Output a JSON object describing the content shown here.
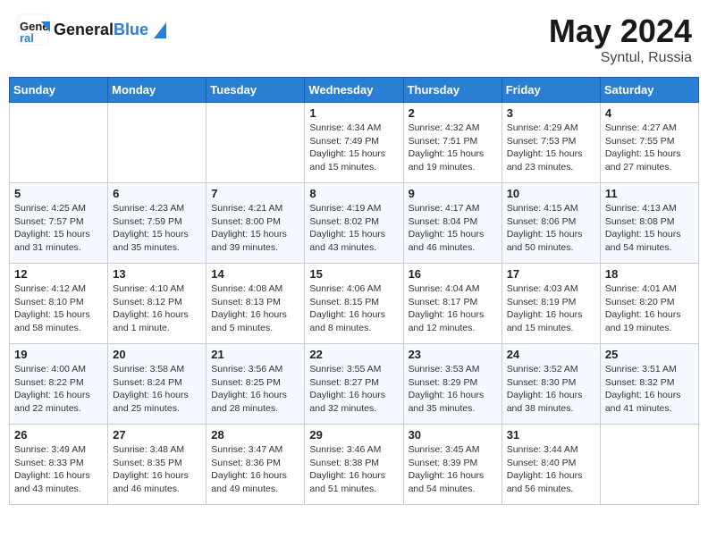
{
  "header": {
    "logo_line1": "General",
    "logo_line2": "Blue",
    "title": "May 2024",
    "location": "Syntul, Russia"
  },
  "weekdays": [
    "Sunday",
    "Monday",
    "Tuesday",
    "Wednesday",
    "Thursday",
    "Friday",
    "Saturday"
  ],
  "weeks": [
    [
      {
        "day": "",
        "info": ""
      },
      {
        "day": "",
        "info": ""
      },
      {
        "day": "",
        "info": ""
      },
      {
        "day": "1",
        "info": "Sunrise: 4:34 AM\nSunset: 7:49 PM\nDaylight: 15 hours\nand 15 minutes."
      },
      {
        "day": "2",
        "info": "Sunrise: 4:32 AM\nSunset: 7:51 PM\nDaylight: 15 hours\nand 19 minutes."
      },
      {
        "day": "3",
        "info": "Sunrise: 4:29 AM\nSunset: 7:53 PM\nDaylight: 15 hours\nand 23 minutes."
      },
      {
        "day": "4",
        "info": "Sunrise: 4:27 AM\nSunset: 7:55 PM\nDaylight: 15 hours\nand 27 minutes."
      }
    ],
    [
      {
        "day": "5",
        "info": "Sunrise: 4:25 AM\nSunset: 7:57 PM\nDaylight: 15 hours\nand 31 minutes."
      },
      {
        "day": "6",
        "info": "Sunrise: 4:23 AM\nSunset: 7:59 PM\nDaylight: 15 hours\nand 35 minutes."
      },
      {
        "day": "7",
        "info": "Sunrise: 4:21 AM\nSunset: 8:00 PM\nDaylight: 15 hours\nand 39 minutes."
      },
      {
        "day": "8",
        "info": "Sunrise: 4:19 AM\nSunset: 8:02 PM\nDaylight: 15 hours\nand 43 minutes."
      },
      {
        "day": "9",
        "info": "Sunrise: 4:17 AM\nSunset: 8:04 PM\nDaylight: 15 hours\nand 46 minutes."
      },
      {
        "day": "10",
        "info": "Sunrise: 4:15 AM\nSunset: 8:06 PM\nDaylight: 15 hours\nand 50 minutes."
      },
      {
        "day": "11",
        "info": "Sunrise: 4:13 AM\nSunset: 8:08 PM\nDaylight: 15 hours\nand 54 minutes."
      }
    ],
    [
      {
        "day": "12",
        "info": "Sunrise: 4:12 AM\nSunset: 8:10 PM\nDaylight: 15 hours\nand 58 minutes."
      },
      {
        "day": "13",
        "info": "Sunrise: 4:10 AM\nSunset: 8:12 PM\nDaylight: 16 hours\nand 1 minute."
      },
      {
        "day": "14",
        "info": "Sunrise: 4:08 AM\nSunset: 8:13 PM\nDaylight: 16 hours\nand 5 minutes."
      },
      {
        "day": "15",
        "info": "Sunrise: 4:06 AM\nSunset: 8:15 PM\nDaylight: 16 hours\nand 8 minutes."
      },
      {
        "day": "16",
        "info": "Sunrise: 4:04 AM\nSunset: 8:17 PM\nDaylight: 16 hours\nand 12 minutes."
      },
      {
        "day": "17",
        "info": "Sunrise: 4:03 AM\nSunset: 8:19 PM\nDaylight: 16 hours\nand 15 minutes."
      },
      {
        "day": "18",
        "info": "Sunrise: 4:01 AM\nSunset: 8:20 PM\nDaylight: 16 hours\nand 19 minutes."
      }
    ],
    [
      {
        "day": "19",
        "info": "Sunrise: 4:00 AM\nSunset: 8:22 PM\nDaylight: 16 hours\nand 22 minutes."
      },
      {
        "day": "20",
        "info": "Sunrise: 3:58 AM\nSunset: 8:24 PM\nDaylight: 16 hours\nand 25 minutes."
      },
      {
        "day": "21",
        "info": "Sunrise: 3:56 AM\nSunset: 8:25 PM\nDaylight: 16 hours\nand 28 minutes."
      },
      {
        "day": "22",
        "info": "Sunrise: 3:55 AM\nSunset: 8:27 PM\nDaylight: 16 hours\nand 32 minutes."
      },
      {
        "day": "23",
        "info": "Sunrise: 3:53 AM\nSunset: 8:29 PM\nDaylight: 16 hours\nand 35 minutes."
      },
      {
        "day": "24",
        "info": "Sunrise: 3:52 AM\nSunset: 8:30 PM\nDaylight: 16 hours\nand 38 minutes."
      },
      {
        "day": "25",
        "info": "Sunrise: 3:51 AM\nSunset: 8:32 PM\nDaylight: 16 hours\nand 41 minutes."
      }
    ],
    [
      {
        "day": "26",
        "info": "Sunrise: 3:49 AM\nSunset: 8:33 PM\nDaylight: 16 hours\nand 43 minutes."
      },
      {
        "day": "27",
        "info": "Sunrise: 3:48 AM\nSunset: 8:35 PM\nDaylight: 16 hours\nand 46 minutes."
      },
      {
        "day": "28",
        "info": "Sunrise: 3:47 AM\nSunset: 8:36 PM\nDaylight: 16 hours\nand 49 minutes."
      },
      {
        "day": "29",
        "info": "Sunrise: 3:46 AM\nSunset: 8:38 PM\nDaylight: 16 hours\nand 51 minutes."
      },
      {
        "day": "30",
        "info": "Sunrise: 3:45 AM\nSunset: 8:39 PM\nDaylight: 16 hours\nand 54 minutes."
      },
      {
        "day": "31",
        "info": "Sunrise: 3:44 AM\nSunset: 8:40 PM\nDaylight: 16 hours\nand 56 minutes."
      },
      {
        "day": "",
        "info": ""
      }
    ]
  ]
}
